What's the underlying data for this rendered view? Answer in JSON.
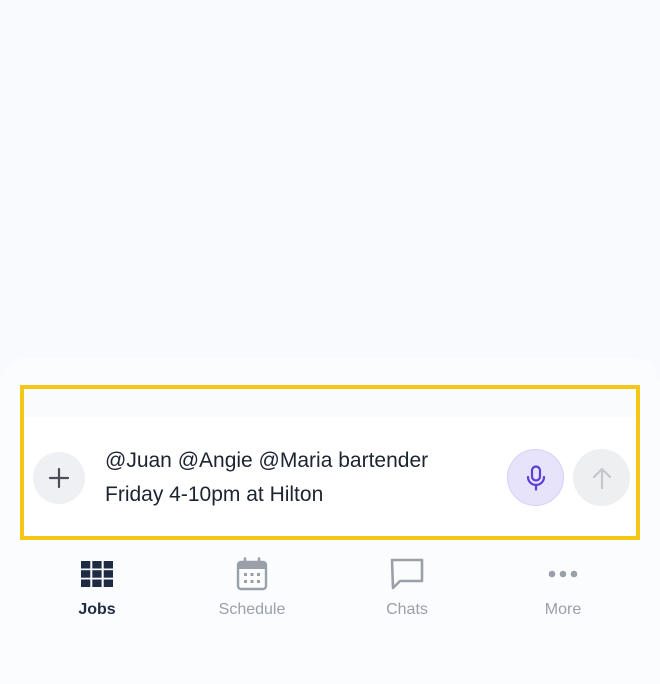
{
  "composer": {
    "message_line1": "@Juan @Angie @Maria bartender",
    "message_line2": "Friday 4-10pm at Hilton",
    "add_icon": "plus-icon",
    "mic_icon": "microphone-icon",
    "send_icon": "arrow-up-icon"
  },
  "tabs": [
    {
      "label": "Jobs",
      "icon": "grid-icon",
      "active": true
    },
    {
      "label": "Schedule",
      "icon": "calendar-icon",
      "active": false
    },
    {
      "label": "Chats",
      "icon": "chat-bubble-icon",
      "active": false
    },
    {
      "label": "More",
      "icon": "more-dots-icon",
      "active": false
    }
  ],
  "colors": {
    "highlight_border": "#f5c518",
    "active_tab": "#1f2a44",
    "inactive_tab": "#9aa0a8",
    "mic_accent": "#5b3fd6",
    "mic_bg": "#e6e3fb"
  }
}
